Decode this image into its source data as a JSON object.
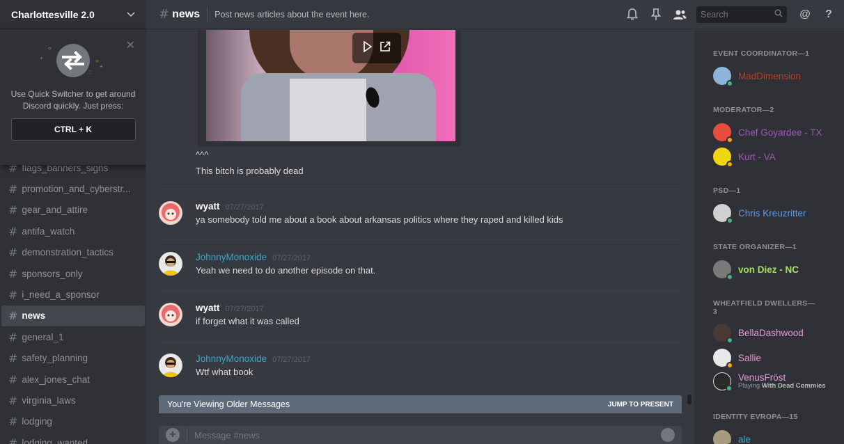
{
  "server": {
    "name": "Charlottesville 2.0"
  },
  "quick_switcher": {
    "text_line1": "Use Quick Switcher to get around",
    "text_line2": "Discord quickly. Just press:",
    "shortcut": "CTRL + K"
  },
  "channels": [
    {
      "name": "flags_banners_signs",
      "active": false
    },
    {
      "name": "promotion_and_cyberstr...",
      "active": false
    },
    {
      "name": "gear_and_attire",
      "active": false
    },
    {
      "name": "antifa_watch",
      "active": false
    },
    {
      "name": "demonstration_tactics",
      "active": false
    },
    {
      "name": "sponsors_only",
      "active": false
    },
    {
      "name": "i_need_a_sponsor",
      "active": false
    },
    {
      "name": "news",
      "active": true
    },
    {
      "name": "general_1",
      "active": false
    },
    {
      "name": "safety_planning",
      "active": false
    },
    {
      "name": "alex_jones_chat",
      "active": false
    },
    {
      "name": "virginia_laws",
      "active": false
    },
    {
      "name": "lodging",
      "active": false
    },
    {
      "name": "lodging_wanted",
      "active": false
    }
  ],
  "header": {
    "channel_name": "news",
    "topic": "Post news articles about the event here.",
    "search_placeholder": "Search",
    "mention_symbol": "@",
    "help_symbol": "?"
  },
  "messages": {
    "continuation1": "^^^",
    "continuation2": "This bitch is probably dead",
    "items": [
      {
        "author": "wyatt",
        "timestamp": "07/27/2017",
        "text": "ya somebody told me about a book about arkansas politics where they raped and killed kids",
        "author_color": "#ffffff"
      },
      {
        "author": "JohnnyMonoxide",
        "timestamp": "07/27/2017",
        "text": "Yeah we need to do another episode on that.",
        "author_color": "#3fa7c6"
      },
      {
        "author": "wyatt",
        "timestamp": "07/27/2017",
        "text": "if forget what it was called",
        "author_color": "#ffffff"
      },
      {
        "author": "JohnnyMonoxide",
        "timestamp": "07/27/2017",
        "text": "Wtf what book",
        "author_color": "#3fa7c6"
      }
    ]
  },
  "older_bar": {
    "text": "You're Viewing Older Messages",
    "jump": "JUMP TO PRESENT"
  },
  "composer": {
    "placeholder": "Message #news"
  },
  "member_groups": [
    {
      "role": "EVENT COORDINATOR—1",
      "members": [
        {
          "name": "MadDimension",
          "color": "#c0392b",
          "status": "online"
        }
      ]
    },
    {
      "role": "MODERATOR—2",
      "members": [
        {
          "name": "Chef Goyardee - TX",
          "color": "#9b59b6",
          "status": "idle"
        },
        {
          "name": "Kurt - VA",
          "color": "#9b59b6",
          "status": "idle"
        }
      ]
    },
    {
      "role": "PSD—1",
      "members": [
        {
          "name": "Chris Kreuzritter",
          "color": "#5d9ce6",
          "status": "online"
        }
      ]
    },
    {
      "role": "STATE ORGANIZER—1",
      "members": [
        {
          "name": "von Diez - NC",
          "color": "#a3e15d",
          "status": "online"
        }
      ]
    },
    {
      "role": "WHEATFIELD DWELLERS—3",
      "members": [
        {
          "name": "BellaDashwood",
          "color": "#e79ad9",
          "status": "online"
        },
        {
          "name": "Sallie",
          "color": "#e79ad9",
          "status": "idle"
        },
        {
          "name": "VenusFröst",
          "color": "#e79ad9",
          "status": "online",
          "game_prefix": "Playing",
          "game": "With Dead Commies"
        }
      ]
    },
    {
      "role": "IDENTITY EVROPA—15",
      "members": [
        {
          "name": "ale",
          "color": "#3fa7c6",
          "status": "online"
        }
      ]
    }
  ],
  "colors": {
    "background": "#36393f",
    "sidebar": "#2f3136",
    "online": "#43b581",
    "idle": "#faa61a"
  }
}
